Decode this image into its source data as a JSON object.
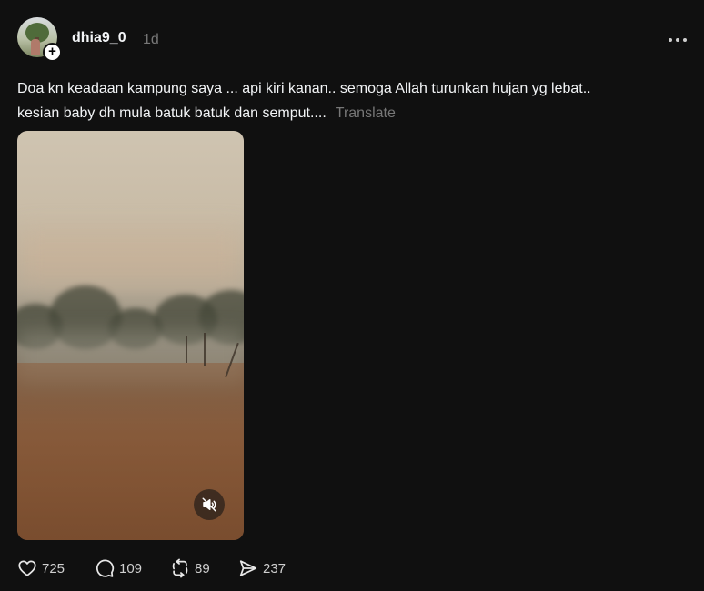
{
  "post": {
    "username": "dhia9_0",
    "time": "1d",
    "caption_line1": "Doa kn keadaan kampung saya ... api kiri kanan.. semoga Allah turunkan hujan yg lebat..",
    "caption_line2": "kesian baby dh mula batuk batuk dan semput....",
    "translate": "Translate"
  },
  "actions": {
    "likes": "725",
    "comments": "109",
    "reposts": "89",
    "shares": "237"
  },
  "icons": {
    "follow": "plus-icon",
    "more": "more-horizontal-icon",
    "mute": "speaker-muted-icon",
    "like": "heart-icon",
    "comment": "comment-bubble-icon",
    "repost": "repost-icon",
    "share": "send-icon"
  },
  "colors": {
    "background": "#101010",
    "text": "#f3f5f7",
    "muted": "#777777"
  }
}
